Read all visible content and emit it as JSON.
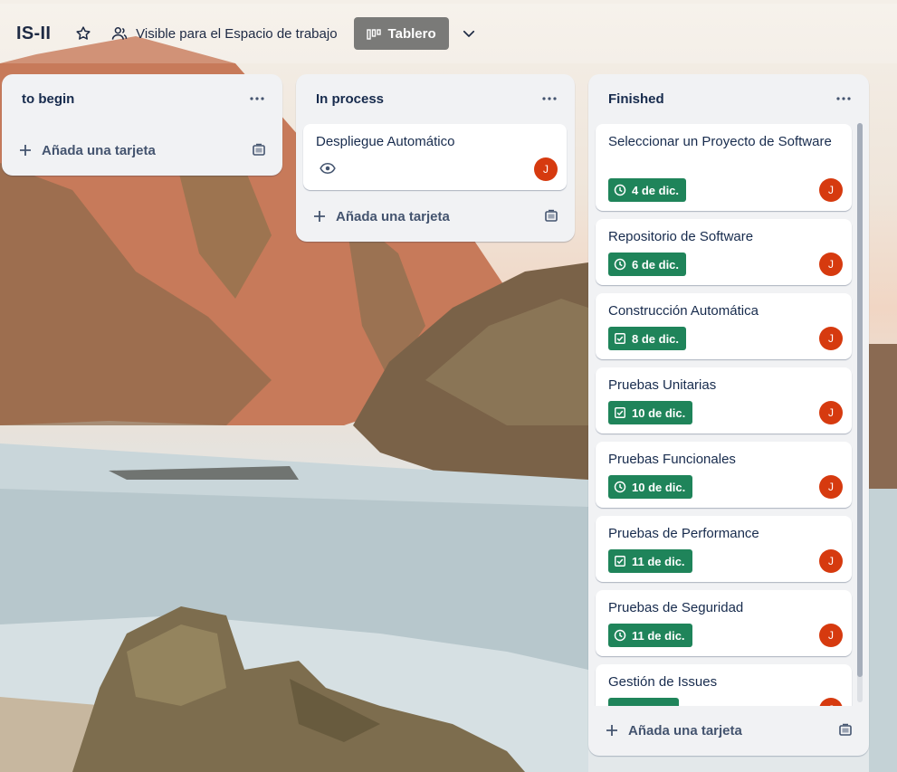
{
  "header": {
    "board_title": "IS-II",
    "visibility_label": "Visible para el Espacio de trabajo",
    "view_label": "Tablero"
  },
  "lists": [
    {
      "title": "to begin",
      "add_label": "Añada una tarjeta",
      "cards": []
    },
    {
      "title": "In process",
      "add_label": "Añada una tarjeta",
      "cards": [
        {
          "title": "Despliegue Automático",
          "member_initial": "J",
          "watching": true
        }
      ]
    },
    {
      "title": "Finished",
      "add_label": "Añada una tarjeta",
      "cards": [
        {
          "title": "Seleccionar un Proyecto de Software",
          "badge": "4 de dic.",
          "badge_icon": "clock-icon",
          "member_initial": "J"
        },
        {
          "title": "Repositorio de Software",
          "badge": "6 de dic.",
          "badge_icon": "clock-icon",
          "member_initial": "J"
        },
        {
          "title": "Construcción Automática",
          "badge": "8 de dic.",
          "badge_icon": "checkbox-icon",
          "member_initial": "J"
        },
        {
          "title": "Pruebas Unitarias",
          "badge": "10 de dic.",
          "badge_icon": "checkbox-icon",
          "member_initial": "J"
        },
        {
          "title": "Pruebas Funcionales",
          "badge": "10 de dic.",
          "badge_icon": "clock-icon",
          "member_initial": "J"
        },
        {
          "title": "Pruebas de Performance",
          "badge": "11 de dic.",
          "badge_icon": "checkbox-icon",
          "member_initial": "J"
        },
        {
          "title": "Pruebas de Seguridad",
          "badge": "11 de dic.",
          "badge_icon": "clock-icon",
          "member_initial": "J"
        },
        {
          "title": "Gestión de Issues",
          "member_initial": "J"
        }
      ]
    }
  ],
  "colors": {
    "badge_complete": "#1f845a",
    "avatar": "#d63a0f",
    "list_bg": "#f1f2f4",
    "view_button": "#7a7a78"
  }
}
